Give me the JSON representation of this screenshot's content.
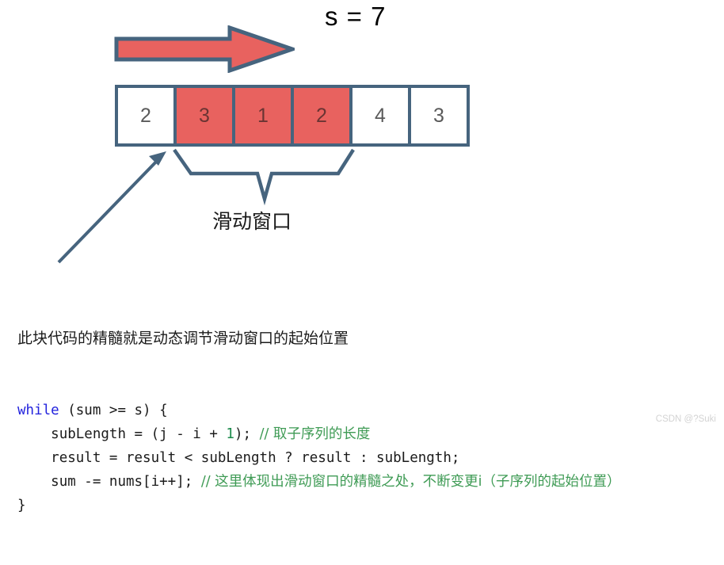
{
  "colors": {
    "outline": "#46647e",
    "highlight_fill": "#e8625f",
    "cell_text": "#5a5a5a",
    "keyword": "#2222dd",
    "comment": "#3f9b55",
    "number": "#1a8a4a",
    "watermark": "#d3d3d3"
  },
  "target_label": "s = 7",
  "array": {
    "cells": [
      {
        "value": "2",
        "highlighted": false
      },
      {
        "value": "3",
        "highlighted": true
      },
      {
        "value": "1",
        "highlighted": true
      },
      {
        "value": "2",
        "highlighted": true
      },
      {
        "value": "4",
        "highlighted": false
      },
      {
        "value": "3",
        "highlighted": false
      }
    ]
  },
  "window_label": "滑动窗口",
  "code": {
    "note": "此块代码的精髓就是动态调节滑动窗口的起始位置",
    "lines": [
      {
        "indent": 0,
        "tokens": [
          {
            "text": "while",
            "style": "kw"
          },
          {
            "text": " (sum >= s) {",
            "style": "plain"
          }
        ]
      },
      {
        "indent": 1,
        "tokens": [
          {
            "text": "subLength = (j - i + ",
            "style": "plain"
          },
          {
            "text": "1",
            "style": "num"
          },
          {
            "text": "); ",
            "style": "plain"
          },
          {
            "text": "// 取子序列的长度",
            "style": "cmt"
          }
        ]
      },
      {
        "indent": 1,
        "tokens": [
          {
            "text": "result = result < subLength ? result : subLength;",
            "style": "plain"
          }
        ]
      },
      {
        "indent": 1,
        "tokens": [
          {
            "text": "sum -= nums[i++]; ",
            "style": "plain"
          },
          {
            "text": "// 这里体现出滑动窗口的精髓之处，不断变更i（子序列的起始位置）",
            "style": "cmt"
          }
        ]
      },
      {
        "indent": 0,
        "tokens": [
          {
            "text": "}",
            "style": "plain"
          }
        ]
      }
    ]
  },
  "watermark": "CSDN @?Suki",
  "icons": {
    "big_arrow": "right-arrow-icon",
    "pointer": "diagonal-arrow-icon",
    "brace": "curly-brace-down-icon"
  }
}
